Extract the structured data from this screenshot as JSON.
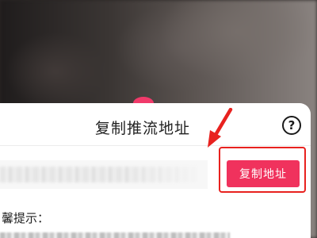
{
  "dialog": {
    "title": "复制推流地址",
    "help_icon": "help-circle-icon",
    "copy_button_label": "复制地址",
    "tip_label": "馨提示：",
    "accent_color": "#f0325d",
    "annotation_color": "#e8221f"
  }
}
